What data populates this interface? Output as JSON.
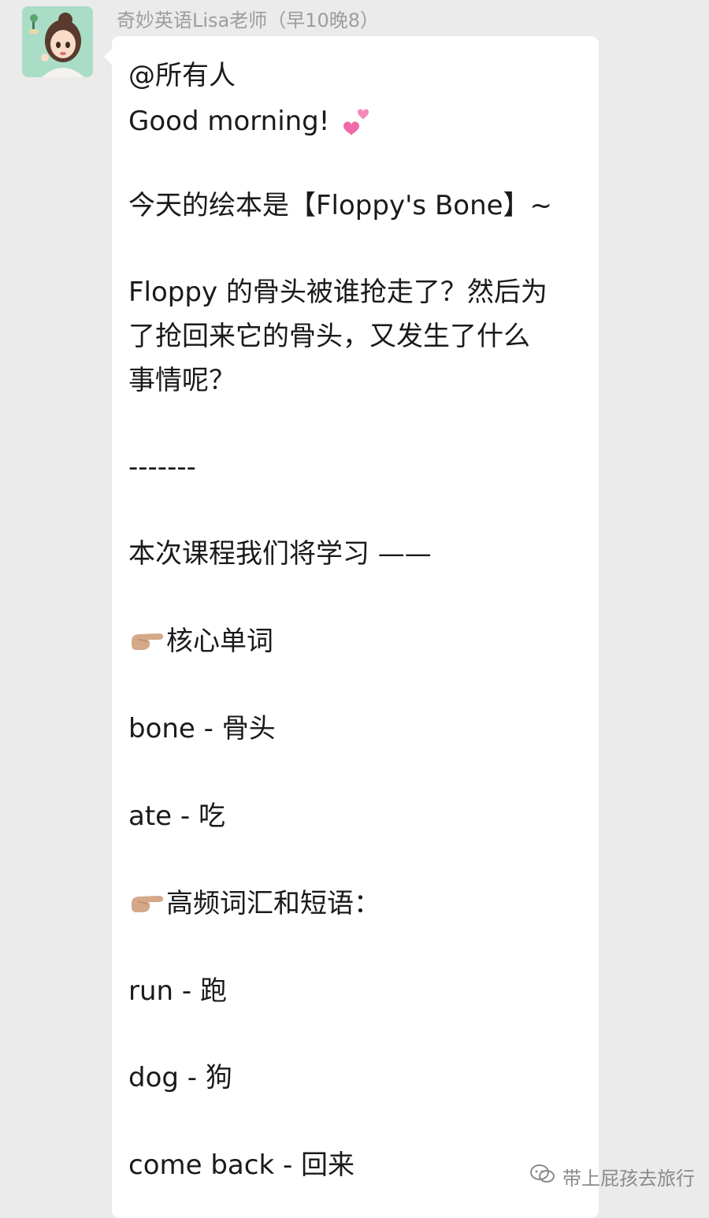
{
  "chat": {
    "sender_name": "奇妙英语Lisa老师（早10晚8）",
    "message": {
      "mention": "@所有人",
      "greeting": "Good morning!",
      "book_intro": "今天的绘本是【Floppy's Bone】~",
      "question_line1": "Floppy 的骨头被谁抢走了？然后为",
      "question_line2": "了抢回来它的骨头，又发生了什么",
      "question_line3": "事情呢？",
      "divider": "-------",
      "course_intro": "本次课程我们将学习 ——",
      "core_words_title": "核心单词",
      "word_bone": "bone - 骨头",
      "word_ate": "ate - 吃",
      "phrases_title": "高频词汇和短语：",
      "word_run": "run - 跑",
      "word_dog": "dog - 狗",
      "word_come_back": "come back - 回来"
    }
  },
  "watermark": {
    "label": "带上屁孩去旅行",
    "icon": "wechat-icon"
  },
  "icons": {
    "greeting_emoji": "two-hearts-icon",
    "section_emoji": "pointing-hand-icon"
  },
  "colors": {
    "background": "#ebebeb",
    "bubble": "#ffffff",
    "text": "#1a1a1a",
    "sender_name": "#9d9d9d",
    "heart": "#f06aa8"
  }
}
